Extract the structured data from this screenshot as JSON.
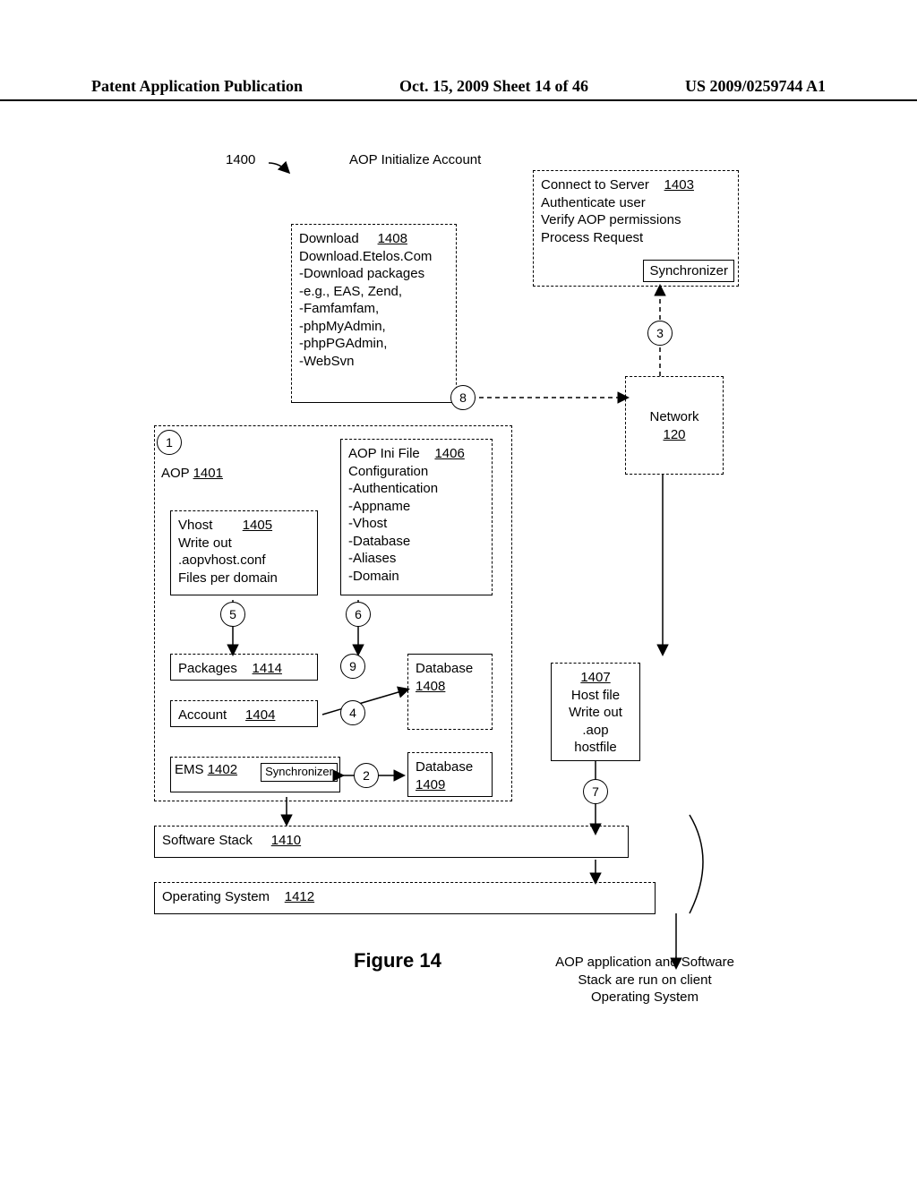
{
  "header": {
    "left": "Patent Application Publication",
    "mid": "Oct. 15, 2009   Sheet 14 of 46",
    "right": "US 2009/0259744 A1"
  },
  "diagram": {
    "ref1400": "1400",
    "title": "AOP Initialize Account",
    "server": {
      "ref": "1403",
      "line1": "Connect to Server",
      "line2": "Authenticate user",
      "line3": "Verify AOP permissions",
      "line4": "Process Request",
      "sync": "Synchronizer"
    },
    "download": {
      "title": "Download",
      "ref": "1408",
      "line2": "Download.Etelos.Com",
      "line3": "-Download packages",
      "line4": "-e.g., EAS, Zend,",
      "line5": "-Famfamfam,",
      "line6": "-phpMyAdmin,",
      "line7": "-phpPGAdmin,",
      "line8": "-WebSvn"
    },
    "network": {
      "title": "Network",
      "ref": "120"
    },
    "aop": {
      "title": "AOP",
      "ref": "1401"
    },
    "vhost": {
      "title": "Vhost",
      "ref": "1405",
      "line2": "Write out",
      "line3": ".aopvhost.conf",
      "line4": "Files per domain"
    },
    "ini": {
      "title": "AOP Ini File",
      "ref": "1406",
      "line2": "Configuration",
      "line3": "-Authentication",
      "line4": "-Appname",
      "line5": "-Vhost",
      "line6": "-Database",
      "line7": "-Aliases",
      "line8": "-Domain"
    },
    "packages": {
      "title": "Packages",
      "ref": "1414"
    },
    "account": {
      "title": "Account",
      "ref": "1404"
    },
    "ems": {
      "title": "EMS",
      "ref": "1402",
      "sync": "Synchronizer"
    },
    "db1": {
      "title": "Database",
      "ref": "1408"
    },
    "db2": {
      "title": "Database",
      "ref": "1409"
    },
    "hostfile": {
      "ref": "1407",
      "line1": "Host file",
      "line2": "Write out",
      "line3": ".aop",
      "line4": "hostfile"
    },
    "swstack": {
      "title": "Software Stack",
      "ref": "1410"
    },
    "os": {
      "title": "Operating System",
      "ref": "1412"
    },
    "steps": {
      "s1": "1",
      "s2": "2",
      "s3": "3",
      "s4": "4",
      "s5": "5",
      "s6": "6",
      "s7": "7",
      "s8": "8",
      "s9": "9"
    },
    "figure": "Figure 14",
    "footnote": "AOP application and Software Stack are run on client Operating System"
  }
}
